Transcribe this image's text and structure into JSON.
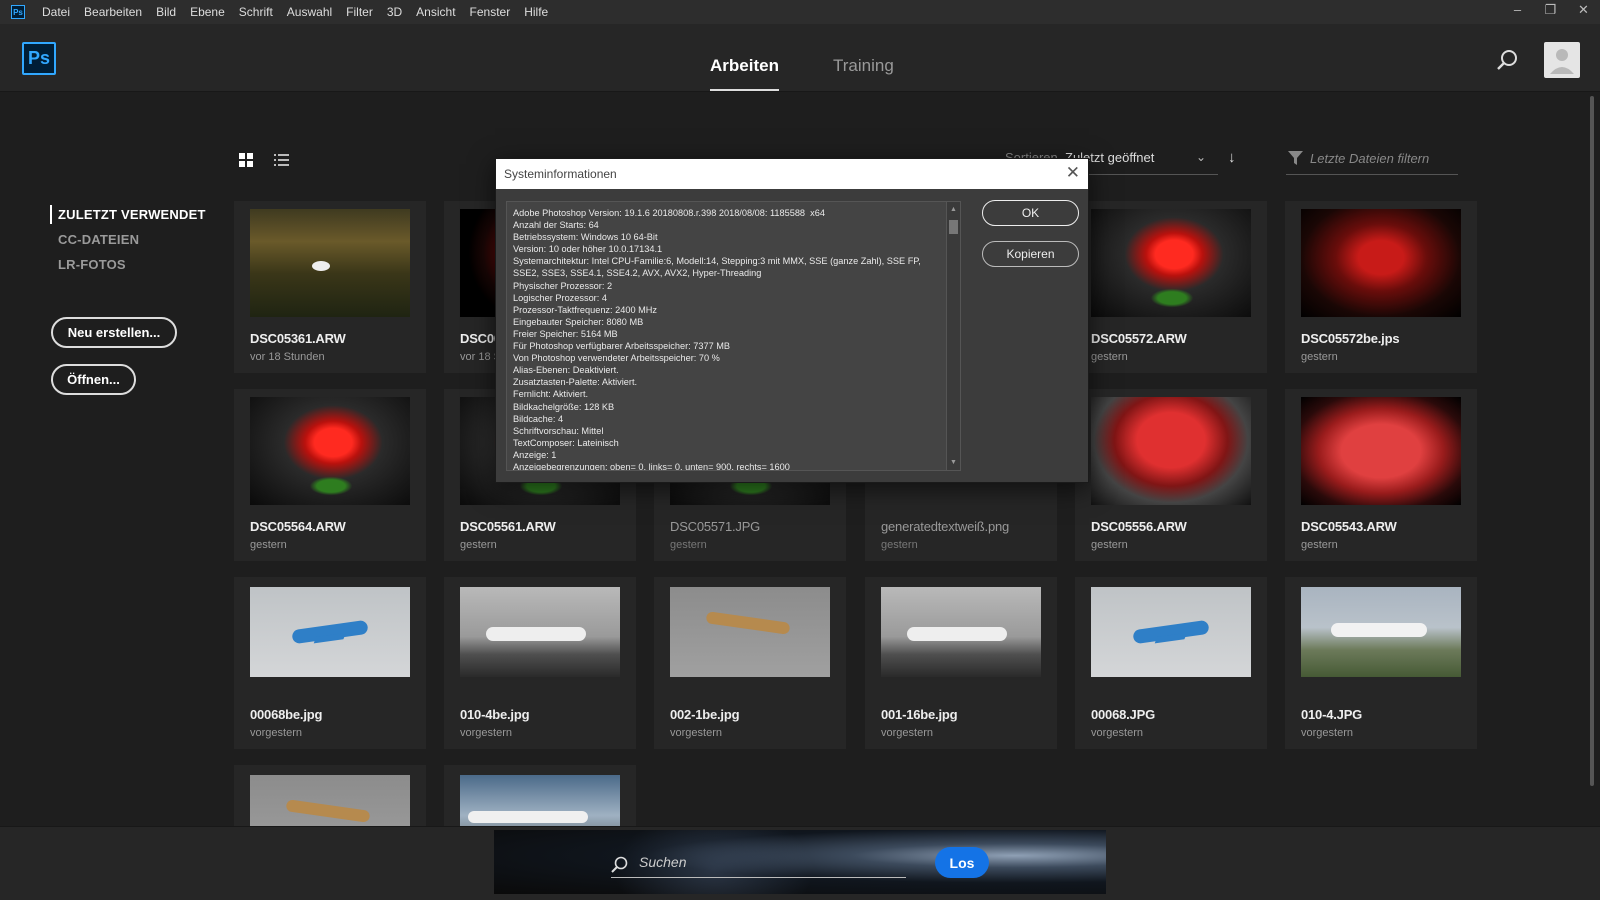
{
  "menubar": {
    "app_badge": "Ps",
    "items": [
      "Datei",
      "Bearbeiten",
      "Bild",
      "Ebene",
      "Schrift",
      "Auswahl",
      "Filter",
      "3D",
      "Ansicht",
      "Fenster",
      "Hilfe"
    ],
    "window_controls": [
      "–",
      "❐",
      "✕"
    ]
  },
  "header": {
    "logo": "Ps",
    "tabs": [
      {
        "label": "Arbeiten",
        "active": true
      },
      {
        "label": "Training",
        "active": false
      }
    ]
  },
  "sidebar": {
    "items": [
      {
        "label": "ZULETZT VERWENDET",
        "active": true
      },
      {
        "label": "CC-DATEIEN",
        "active": false
      },
      {
        "label": "LR-FOTOS",
        "active": false
      }
    ],
    "new_button": "Neu erstellen...",
    "open_button": "Öffnen..."
  },
  "toolbar": {
    "sort_label": "Sortieren",
    "sort_value": "Zuletzt geöffnet",
    "sort_direction_icon": "↓",
    "filter_placeholder": "Letzte Dateien filtern"
  },
  "files": [
    {
      "name": "DSC05361.ARW",
      "date": "vor 18 Stunden",
      "thumb": "t-swan"
    },
    {
      "name": "DSC00",
      "date": "vor 18 St",
      "thumb": "t-darkrose"
    },
    {
      "name": "",
      "date": "",
      "thumb": ""
    },
    {
      "name": "",
      "date": "",
      "thumb": ""
    },
    {
      "name": "DSC05572.ARW",
      "date": "gestern",
      "thumb": "t-rose"
    },
    {
      "name": "DSC05572be.jps",
      "date": "gestern",
      "thumb": "t-redleaf"
    },
    {
      "name": "DSC05564.ARW",
      "date": "gestern",
      "thumb": "t-rose"
    },
    {
      "name": "DSC05561.ARW",
      "date": "gestern",
      "thumb": "t-rose"
    },
    {
      "name": "DSC05571.JPG",
      "date": "gestern",
      "thumb": "t-rose",
      "dim": true
    },
    {
      "name": "generatedtextweiß.png",
      "date": "gestern",
      "thumb": "",
      "dim": true
    },
    {
      "name": "DSC05556.ARW",
      "date": "gestern",
      "thumb": "t-glass"
    },
    {
      "name": "DSC05543.ARW",
      "date": "gestern",
      "thumb": "t-glass2"
    },
    {
      "name": "00068be.jpg",
      "date": "vorgestern",
      "thumb": "t-sky"
    },
    {
      "name": "010-4be.jpg",
      "date": "vorgestern",
      "thumb": "t-bw"
    },
    {
      "name": "002-1be.jpg",
      "date": "vorgestern",
      "thumb": "t-gray"
    },
    {
      "name": "001-16be.jpg",
      "date": "vorgestern",
      "thumb": "t-bw"
    },
    {
      "name": "00068.JPG",
      "date": "vorgestern",
      "thumb": "t-sky"
    },
    {
      "name": "010-4.JPG",
      "date": "vorgestern",
      "thumb": "t-color-land"
    },
    {
      "name": "",
      "date": "",
      "thumb": "t-gray"
    },
    {
      "name": "",
      "date": "",
      "thumb": "t-clouds"
    }
  ],
  "dialog": {
    "title": "Systeminformationen",
    "ok_label": "OK",
    "copy_label": "Kopieren",
    "lines": [
      "Adobe Photoshop Version: 19.1.6 20180808.r.398 2018/08/08: 1185588  x64",
      "Anzahl der Starts: 64",
      "Betriebssystem: Windows 10 64-Bit",
      "Version: 10 oder höher 10.0.17134.1",
      "Systemarchitektur: Intel CPU-Familie:6, Modell:14, Stepping:3 mit MMX, SSE (ganze Zahl), SSE FP, SSE2, SSE3, SSE4.1, SSE4.2, AVX, AVX2, Hyper-Threading",
      "Physischer Prozessor: 2",
      "Logischer Prozessor: 4",
      "Prozessor-Taktfrequenz: 2400 MHz",
      "Eingebauter Speicher: 8080 MB",
      "Freier Speicher: 5164 MB",
      "Für Photoshop verfügbarer Arbeitsspeicher: 7377 MB",
      "Von Photoshop verwendeter Arbeitsspeicher: 70 %",
      "Alias-Ebenen: Deaktiviert.",
      "Zusatztasten-Palette: Aktiviert.",
      "Fernlicht: Aktiviert.",
      "Bildkachelgröße: 128 KB",
      "Bildcache: 4",
      "Schriftvorschau: Mittel",
      "TextComposer: Lateinisch",
      "Anzeige: 1",
      "Anzeigebegrenzungen: oben= 0, links= 0, unten= 900, rechts= 1600"
    ]
  },
  "bottom_search": {
    "placeholder": "Suchen",
    "go_label": "Los"
  },
  "colors": {
    "accent_blue": "#1473e6",
    "ps_blue": "#31a8ff"
  }
}
